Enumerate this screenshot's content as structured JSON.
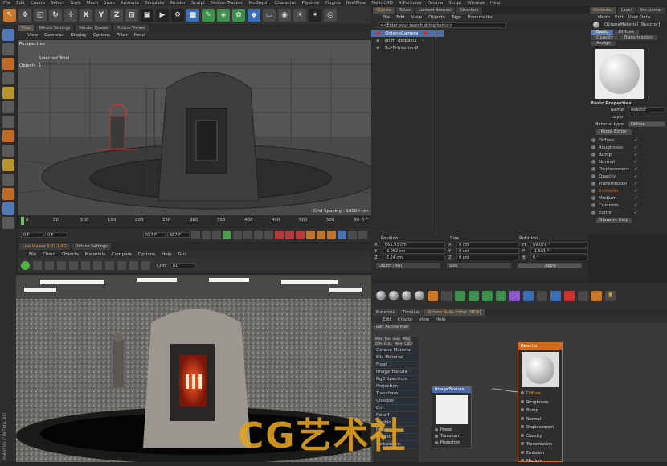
{
  "menu": [
    "File",
    "Edit",
    "Create",
    "Select",
    "Tools",
    "Mesh",
    "Snap",
    "Animate",
    "Simulate",
    "Render",
    "Sculpt",
    "Motion Tracker",
    "MoGraph",
    "Character",
    "Pipeline",
    "Plugins",
    "RealFlow",
    "MeltoC4D",
    "X-Particles",
    "Octane",
    "Script",
    "Window",
    "Help"
  ],
  "toolbar": {
    "axis_x": "X",
    "axis_y": "Y",
    "axis_z": "Z"
  },
  "viewport": {
    "tabs": [
      "View",
      "Rotate Settings",
      "Render Queue",
      "Picture Viewer"
    ],
    "menu": [
      "View",
      "Cameras",
      "Display",
      "Options",
      "Filter",
      "Panel"
    ],
    "label": "Perspective",
    "selected": "Selected Total",
    "objects_label": "Objects",
    "objects_count": "1",
    "grid_spacing": "Grid Spacing : 10000 cm"
  },
  "timeline": {
    "ticks": [
      "0",
      "50",
      "100",
      "150",
      "200",
      "250",
      "300",
      "350",
      "400",
      "450",
      "500",
      "550",
      "60"
    ],
    "frame_end": "0 F",
    "start": "0 F",
    "current": "0 F",
    "end": "557 F",
    "end2": "557 F"
  },
  "liveviewer": {
    "tabs": [
      "Live Viewer 3.01.1-R2",
      "Octane Settings"
    ],
    "menu": [
      "File",
      "Cloud",
      "Objects",
      "Materials",
      "Compare",
      "Options",
      "Help",
      "Gui"
    ],
    "chn_label": "Chn:",
    "chn_value": "DL"
  },
  "objects": {
    "tabs": [
      "Objects",
      "Takes",
      "Content Browser",
      "Structure"
    ],
    "menu": [
      "File",
      "Edit",
      "View",
      "Objects",
      "Tags",
      "Bookmarks"
    ],
    "search_placeholder": "<<Enter your search string here>>",
    "items": [
      "OctaneCamera",
      "anim_global01",
      "Sci-Fi-Interior-8"
    ]
  },
  "attributes": {
    "tabs": [
      "Attributes",
      "Layer",
      "Arc Limiter"
    ],
    "menu": [
      "Mode",
      "Edit",
      "User Data"
    ],
    "title": "OctaneMaterial [Reactor]",
    "subtabs": [
      "Basic",
      "Diffuse",
      "Opacity",
      "Transmission",
      "Assign"
    ],
    "section": "Basic Properties",
    "name_label": "Name",
    "name_value": "Reactor",
    "layer_label": "Layer",
    "mattype_label": "Material type",
    "mattype_value": "Diffuse",
    "node_editor_btn": "Node Editor",
    "channels": [
      "Diffuse",
      "Roughness",
      "Bump",
      "Normal",
      "Displacement",
      "Opacity",
      "Transmission",
      "Emission",
      "Medium",
      "Common",
      "Editor"
    ],
    "show_help": "Show in Help"
  },
  "coords": {
    "headers": [
      "Position",
      "Size",
      "Rotation"
    ],
    "rows": [
      {
        "axis": "X",
        "pos": "665.93 cm",
        "size": "0 cm",
        "rlabel": "H",
        "rot": "69.078 °"
      },
      {
        "axis": "Y",
        "pos": "-3.052 cm",
        "size": "0 cm",
        "rlabel": "P",
        "rot": "-1.501 °"
      },
      {
        "axis": "Z",
        "pos": "-2.24 cm",
        "size": "0 cm",
        "rlabel": "B",
        "rot": "0 °"
      }
    ],
    "mode": "Object (Rel)",
    "size_mode": "Size",
    "apply": "Apply"
  },
  "materials": {
    "tabs": [
      "Materials",
      "Timeline",
      "Octane Node Editor [NEW]"
    ],
    "menu": [
      "Edit",
      "Create",
      "View",
      "Help"
    ]
  },
  "node_editor": {
    "get_active": "Get Active Mat",
    "cat_tabs": [
      "Mat",
      "Tex",
      "Gen",
      "Map",
      "Oth",
      "Ems",
      "Med",
      "C4D"
    ],
    "list": [
      "Octane Material",
      "Mix Material",
      "Float",
      "Image Texture",
      "RgB Spectrum",
      "Projection",
      "Transform",
      "Checker",
      "Dirt",
      "Falloff",
      "Marble",
      "Noise",
      "Ridged",
      "Turbulence"
    ],
    "imgtex": {
      "title": "ImageTexture",
      "ports": [
        "Power",
        "Transform",
        "Projection"
      ]
    },
    "reactor": {
      "title": "Reactor",
      "ports": [
        "Diffuse",
        "Roughness",
        "Bump",
        "Normal",
        "Displacement",
        "Opacity",
        "Transmission",
        "Emission",
        "Medium"
      ]
    }
  },
  "brand": {
    "maxon": "MAXON CINEMA 4D"
  },
  "watermark": "CG艺术社",
  "colors": {
    "accent": "#e3a04b",
    "selected": "#4a6fa8",
    "reactor_header": "#d26a1e",
    "emission": "#e0732a"
  }
}
